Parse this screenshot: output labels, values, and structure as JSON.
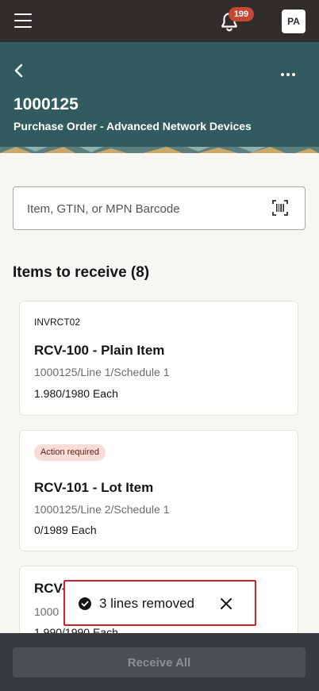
{
  "topbar": {
    "menu_icon": "hamburger-menu-icon",
    "notification_icon": "bell-icon",
    "notification_count": "199",
    "avatar_initials": "PA"
  },
  "header": {
    "back_icon": "chevron-left-icon",
    "more_icon": "more-horizontal-icon",
    "po_number": "1000125",
    "subtitle": "Purchase Order - Advanced Network Devices",
    "background_color": "#325b5f"
  },
  "search": {
    "placeholder": "Item, GTIN, or MPN Barcode",
    "value": "",
    "scan_icon": "barcode-scan-icon"
  },
  "items_section": {
    "title": "Items to receive (8)"
  },
  "items": [
    {
      "code": "INVRCT02",
      "title": "RCV-100 - Plain Item",
      "line": "1000125/Line 1/Schedule 1",
      "quantity": "1.980/1980 Each"
    },
    {
      "badge": "Action required",
      "title": "RCV-101 - Lot Item",
      "line": "1000125/Line 2/Schedule 1",
      "quantity": "0/1989 Each"
    },
    {
      "title": "RCV-",
      "line": "1000",
      "quantity": "1.990/1990 Each"
    }
  ],
  "toast": {
    "icon": "check-circle-icon",
    "message": "3 lines removed",
    "close_icon": "close-icon"
  },
  "footer": {
    "receive_all_label": "Receive All"
  }
}
